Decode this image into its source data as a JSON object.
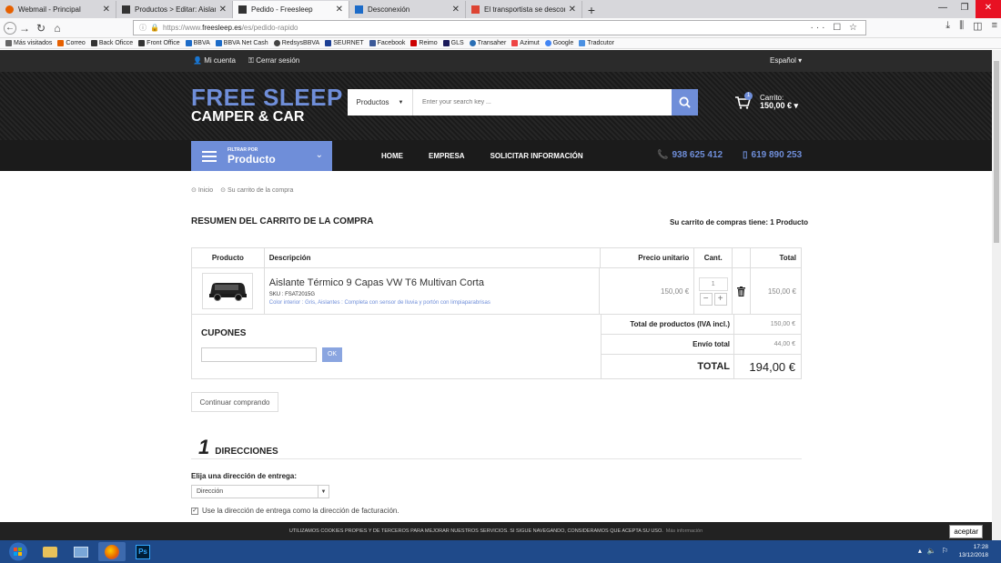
{
  "browser": {
    "tabs": [
      {
        "label": "Webmail - Principal",
        "color": "#e66000"
      },
      {
        "label": "Productos > Editar: Aislante Té",
        "color": "#333"
      },
      {
        "label": "Pedido - Freesleep",
        "color": "#333",
        "active": true
      },
      {
        "label": "Desconexión",
        "color": "#1c6bc8"
      },
      {
        "label": "El transportista se desconfigura",
        "color": "#d43"
      }
    ],
    "url_prefix": "https://www.",
    "url_host": "freesleep.es",
    "url_path": "/es/pedido-rapido",
    "url_actions": "··· ☐ ☆",
    "bookmarks": [
      "Más visitados",
      "Correo",
      "Back Oficce",
      "Front Office",
      "BBVA",
      "BBVA Net Cash",
      "RedsysBBVA",
      "SEURNET",
      "Facebook",
      "Reimo",
      "GLS",
      "Transaher",
      "Azimut",
      "Google",
      "Tradcutor"
    ]
  },
  "site": {
    "account": "Mi cuenta",
    "logout": "Cerrar sesión",
    "language": "Español ▾",
    "logo_line1": "FREE SLEEP",
    "logo_line2": "CAMPER & CAR",
    "search_category": "Productos",
    "search_placeholder": "Enter your search key ...",
    "cart_label": "Carrito:",
    "cart_total": "150,00 € ▾",
    "cart_badge": "1",
    "filter_small": "FILTRAR POR",
    "filter_big": "Producto",
    "menu": [
      "HOME",
      "EMPRESA",
      "SOLICITAR INFORMACIÓN"
    ],
    "phone1": "938 625 412",
    "phone2": "619 890 253",
    "accent": "#6f8ed9"
  },
  "page": {
    "breadcrumb": [
      "Inicio",
      "Su carrito de la compra"
    ],
    "summary_title": "RESUMEN DEL CARRITO DE LA COMPRA",
    "cart_count": "Su carrito de compras tiene: 1 Producto",
    "table_headers": [
      "Producto",
      "Descripción",
      "Precio unitario",
      "Cant.",
      "",
      "Total"
    ],
    "product": {
      "name": "Aislante Térmico 9 Capas VW T6 Multivan Corta",
      "sku": "SKU : FSAT2015G",
      "attributes": "Color interior : Gris, Aislantes : Completa con sensor de lluvia y portón con limpiaparabrisas",
      "unit_price": "150,00 €",
      "qty": "1",
      "total": "150,00 €"
    },
    "coupons_title": "CUPONES",
    "coupon_button": "OK",
    "totals": [
      {
        "label": "Total de productos (IVA incl.)",
        "value": "150,00 €"
      },
      {
        "label": "Envío total",
        "value": "44,00 €"
      },
      {
        "label": "TOTAL",
        "value": "194,00 €"
      }
    ],
    "continue_button": "Continuar comprando",
    "step_number": "1",
    "step_title": "DIRECCIONES",
    "address_label": "Elija una dirección de entrega:",
    "address_select": "Dirección",
    "same_address_label": "Use la dirección de entrega como la dirección de facturación."
  },
  "cookie": {
    "text": "UTILIZAMOS COOKIES PROPIES Y DE TERCEROS PARA MEJORAR NUESTROS SERVICIOS. SI SIGUE NAVEGANDO, CONSIDERAMOS QUE ACEPTA SU USO.",
    "info": "Más información",
    "accept": "aceptar"
  },
  "taskbar": {
    "time": "17:28",
    "date": "13/12/2018"
  }
}
